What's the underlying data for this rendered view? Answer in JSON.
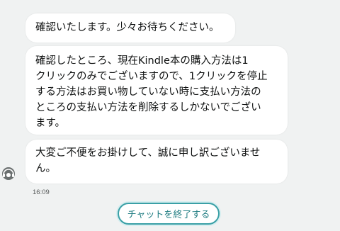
{
  "chat": {
    "messages": [
      {
        "lines": [
          "確認いたします。少々お待ちください。"
        ]
      },
      {
        "lines": [
          "確認したところ、現在Kindle本の購入方法は1",
          "クリックのみでございますので、1クリックを停止",
          "する方法はお買い物していない時に支払い方法の",
          "ところの支払い方法を削除するしかないでござい",
          "ます。"
        ]
      },
      {
        "lines": [
          "大変ご不便をお掛けして、誠に申し訳ございませ",
          "ん。"
        ]
      }
    ],
    "timestamp": "16:09",
    "end_chat_label": "チャットを終了する",
    "avatar_icon": "headset-agent-icon"
  }
}
